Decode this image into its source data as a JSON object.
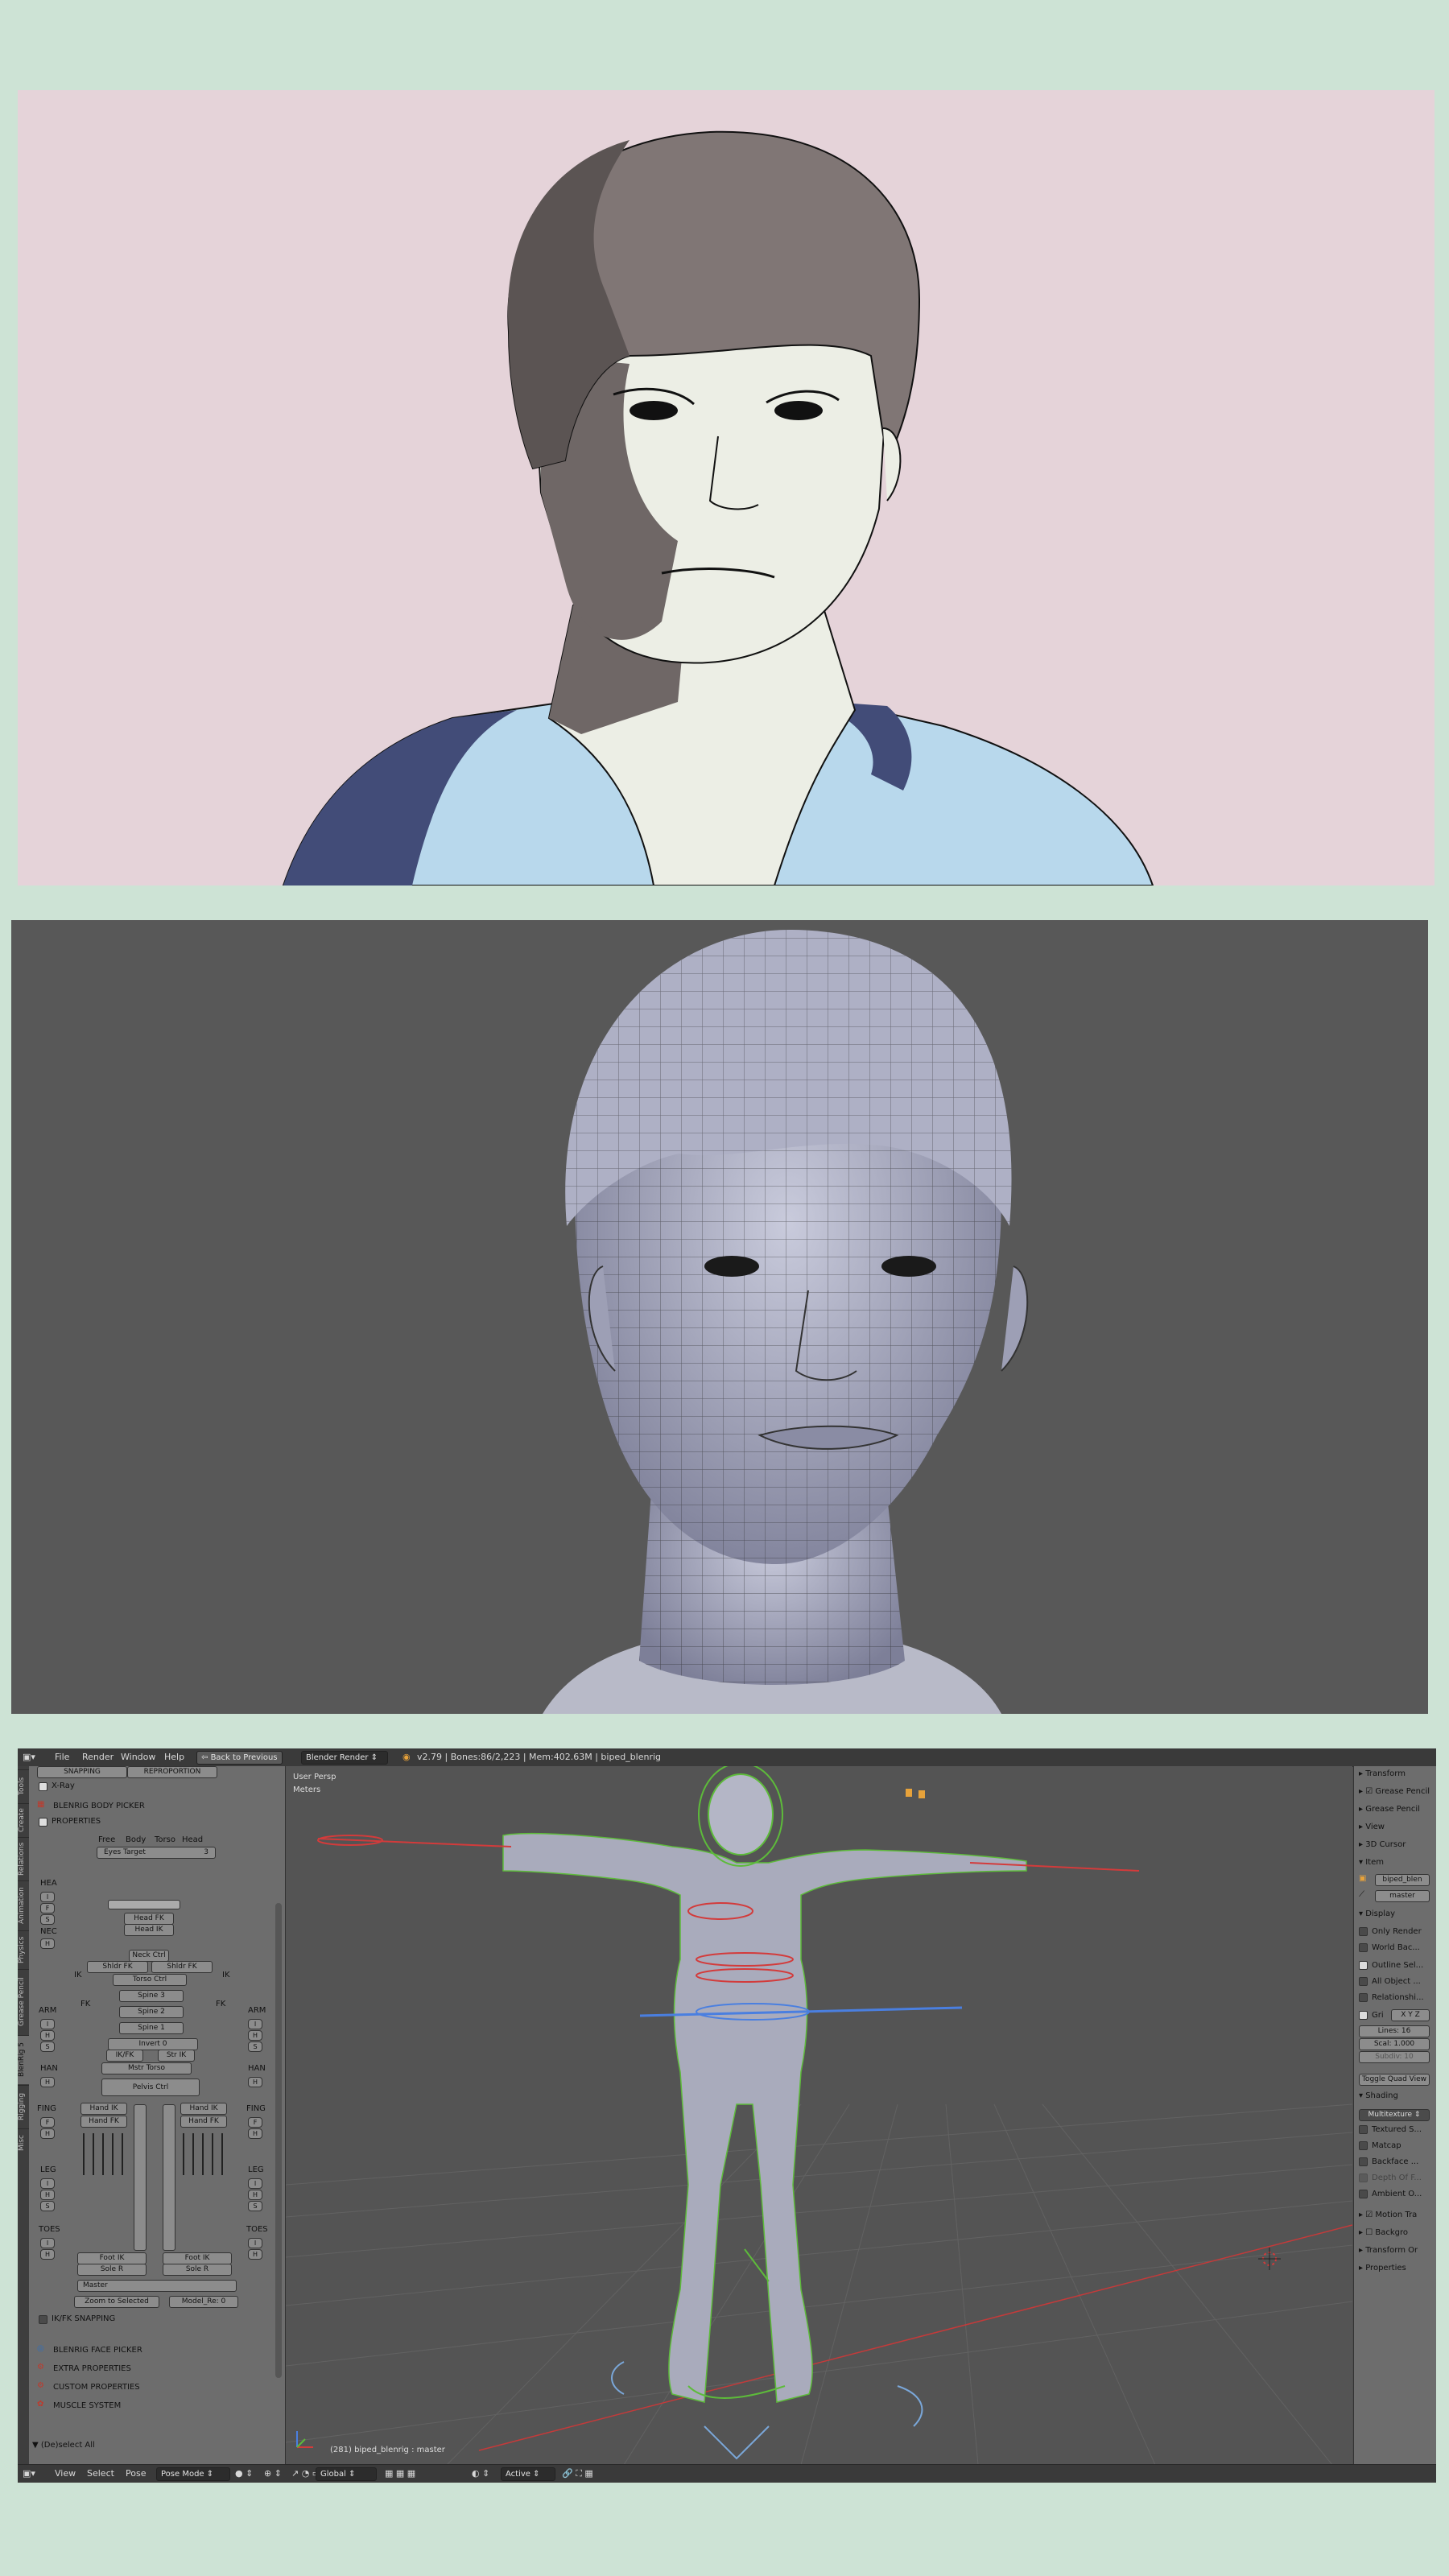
{
  "blender": {
    "menu": [
      "File",
      "Render",
      "Window",
      "Help"
    ],
    "back_to_previous": "Back to Previous",
    "render_engine": "Blender Render",
    "stats": "v2.79 | Bones:86/2,223 | Mem:402.63M | biped_blenrig",
    "tool_tabs": [
      "Tools",
      "Create",
      "Relations",
      "Animation",
      "Physics",
      "Grease Pencil",
      "BlenRig 5",
      "Rigging",
      "Misc"
    ],
    "toolshelf": {
      "snapping": "SNAPPING",
      "reproportion": "REPROPORTION",
      "xray": "X-Ray",
      "body_picker": "BLENRIG BODY PICKER",
      "properties": "PROPERTIES",
      "tabs": [
        "Free",
        "Body",
        "Torso",
        "Head"
      ],
      "eyes_target": "Eyes Target",
      "eyes_target_val": "3",
      "labels": {
        "hea": "HEA",
        "nec": "NEC",
        "arm": "ARM",
        "han": "HAN",
        "fing": "FING",
        "leg": "LEG",
        "toes": "TOES",
        "ik": "IK",
        "fk": "FK"
      },
      "buttons": [
        "Head FK",
        "Head IK",
        "Neck Ctrl",
        "Shldr FK",
        "Torso Ctrl",
        "Spine 3",
        "Spine 2",
        "Spine 1",
        "Invert 0",
        "IK/FK",
        "Str IK",
        "Mstr Torso",
        "Pelvis Ctrl",
        "Hand IK",
        "Hand FK",
        "Foot IK",
        "Sole R",
        "Master",
        "Zoom to Selected",
        "Model_Re: 0"
      ],
      "ikfk_snapping": "IK/FK SNAPPING",
      "face_picker": "BLENRIG FACE PICKER",
      "extra_props": "EXTRA PROPERTIES",
      "custom_props": "CUSTOM PROPERTIES",
      "muscle_system": "MUSCLE SYSTEM",
      "deselect_all": "(De)select All"
    },
    "viewport": {
      "persp": "User Persp",
      "units": "Meters",
      "frame_info": "(281) biped_blenrig : master"
    },
    "npanel": {
      "sections": [
        "Transform",
        "Grease Pencil",
        "Grease Pencil",
        "View",
        "3D Cursor",
        "Item"
      ],
      "item_name": "biped_blen",
      "item_bone": "master",
      "display": "Display",
      "display_opts": [
        "Only Render",
        "World Bac...",
        "Outline Sel...",
        "All Object ...",
        "Relationshi..."
      ],
      "grid": "Gri",
      "lines": "Lines:  16",
      "scale": "Scal:  1.000",
      "subdiv": "Subdiv: 10",
      "toggle_quad": "Toggle Quad View",
      "shading": "Shading",
      "shading_mode": "Multitexture",
      "shading_opts": [
        "Textured S...",
        "Matcap",
        "Backface ...",
        "Depth Of F...",
        "Ambient O..."
      ],
      "motion": "Motion Tra",
      "background": "Backgro",
      "transform_orient": "Transform Or",
      "properties": "Properties"
    },
    "bottom": {
      "menu": [
        "View",
        "Select",
        "Pose"
      ],
      "mode": "Pose Mode",
      "orientation": "Global",
      "pivot": "Active"
    },
    "colors": {
      "accent_red": "#d33b3b",
      "wire_green": "#5dbb3a",
      "wire_blue": "#4a7fe0",
      "highlight": "#e7a23a"
    }
  }
}
